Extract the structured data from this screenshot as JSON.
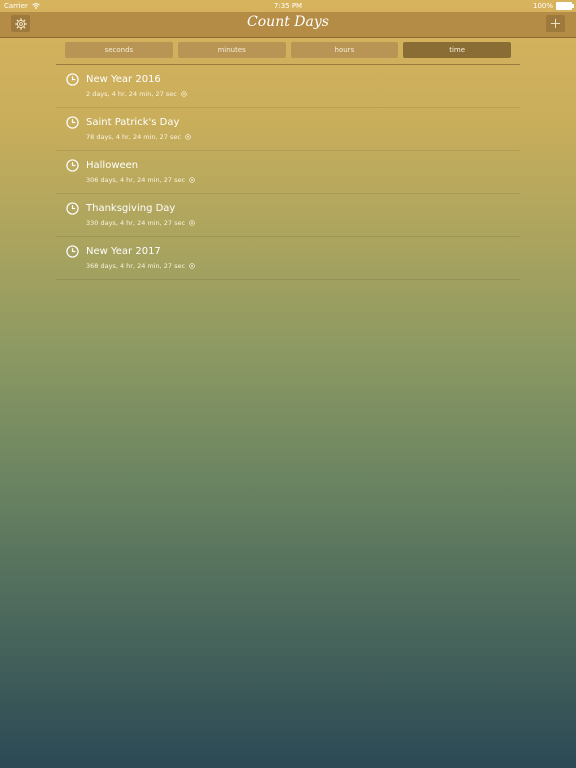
{
  "status_bar": {
    "carrier": "Carrier",
    "time": "7:35 PM",
    "battery": "100%"
  },
  "nav": {
    "title": "Count Days",
    "left_icon": "gear-icon",
    "right_icon": "plus-icon"
  },
  "segments": [
    {
      "label": "seconds",
      "active": false
    },
    {
      "label": "minutes",
      "active": false
    },
    {
      "label": "hours",
      "active": false
    },
    {
      "label": "time",
      "active": true
    }
  ],
  "events": [
    {
      "title": "New Year 2016",
      "countdown": "2 days, 4 hr, 24 min, 27 sec"
    },
    {
      "title": "Saint Patrick's Day",
      "countdown": "78 days, 4 hr, 24 min, 27 sec"
    },
    {
      "title": "Halloween",
      "countdown": "306 days, 4 hr, 24 min, 27 sec"
    },
    {
      "title": "Thanksgiving Day",
      "countdown": "330 days, 4 hr, 24 min, 27 sec"
    },
    {
      "title": "New Year 2017",
      "countdown": "368 days, 4 hr, 24 min, 27 sec"
    }
  ],
  "colors": {
    "nav_bar": "#b48c46",
    "segment": "#b89555",
    "segment_active": "#8a6d34",
    "gradient_top": "#d8b35e",
    "gradient_bottom": "#2b4955"
  }
}
